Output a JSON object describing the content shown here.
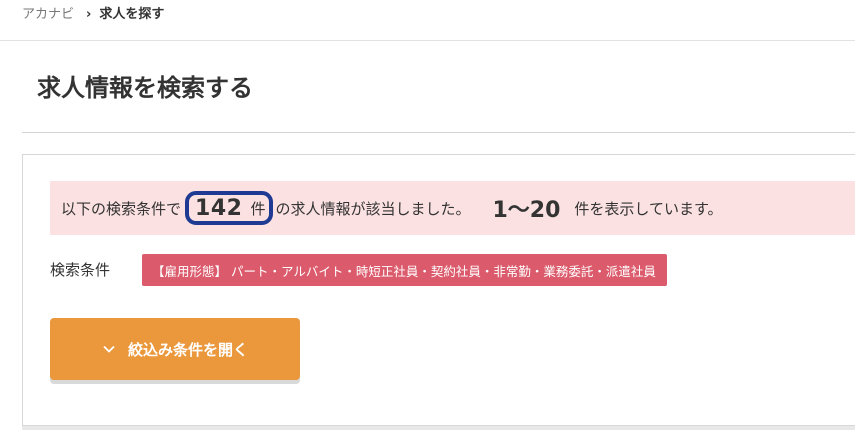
{
  "breadcrumb": {
    "home": "アカナビ",
    "separator": "›",
    "current": "求人を探す"
  },
  "page": {
    "title": "求人情報を検索する"
  },
  "summary": {
    "prefix": "以下の検索条件で",
    "count": "142",
    "count_unit": "件",
    "middle": "の求人情報が該当しました。",
    "range": "1〜20",
    "suffix": "件を表示しています。"
  },
  "conditions": {
    "label": "検索条件",
    "badge": "【雇用形態】 パート・アルバイト・時短正社員・契約社員・非常勤・業務委託・派遣社員"
  },
  "filter_button": {
    "label": "絞込み条件を開く",
    "icon": "chevron-down-icon"
  },
  "colors": {
    "summary_bg": "#fbe1e1",
    "count_highlight": "#1f3a93",
    "badge_bg": "#db5b6c",
    "button_bg": "#eb973b"
  }
}
